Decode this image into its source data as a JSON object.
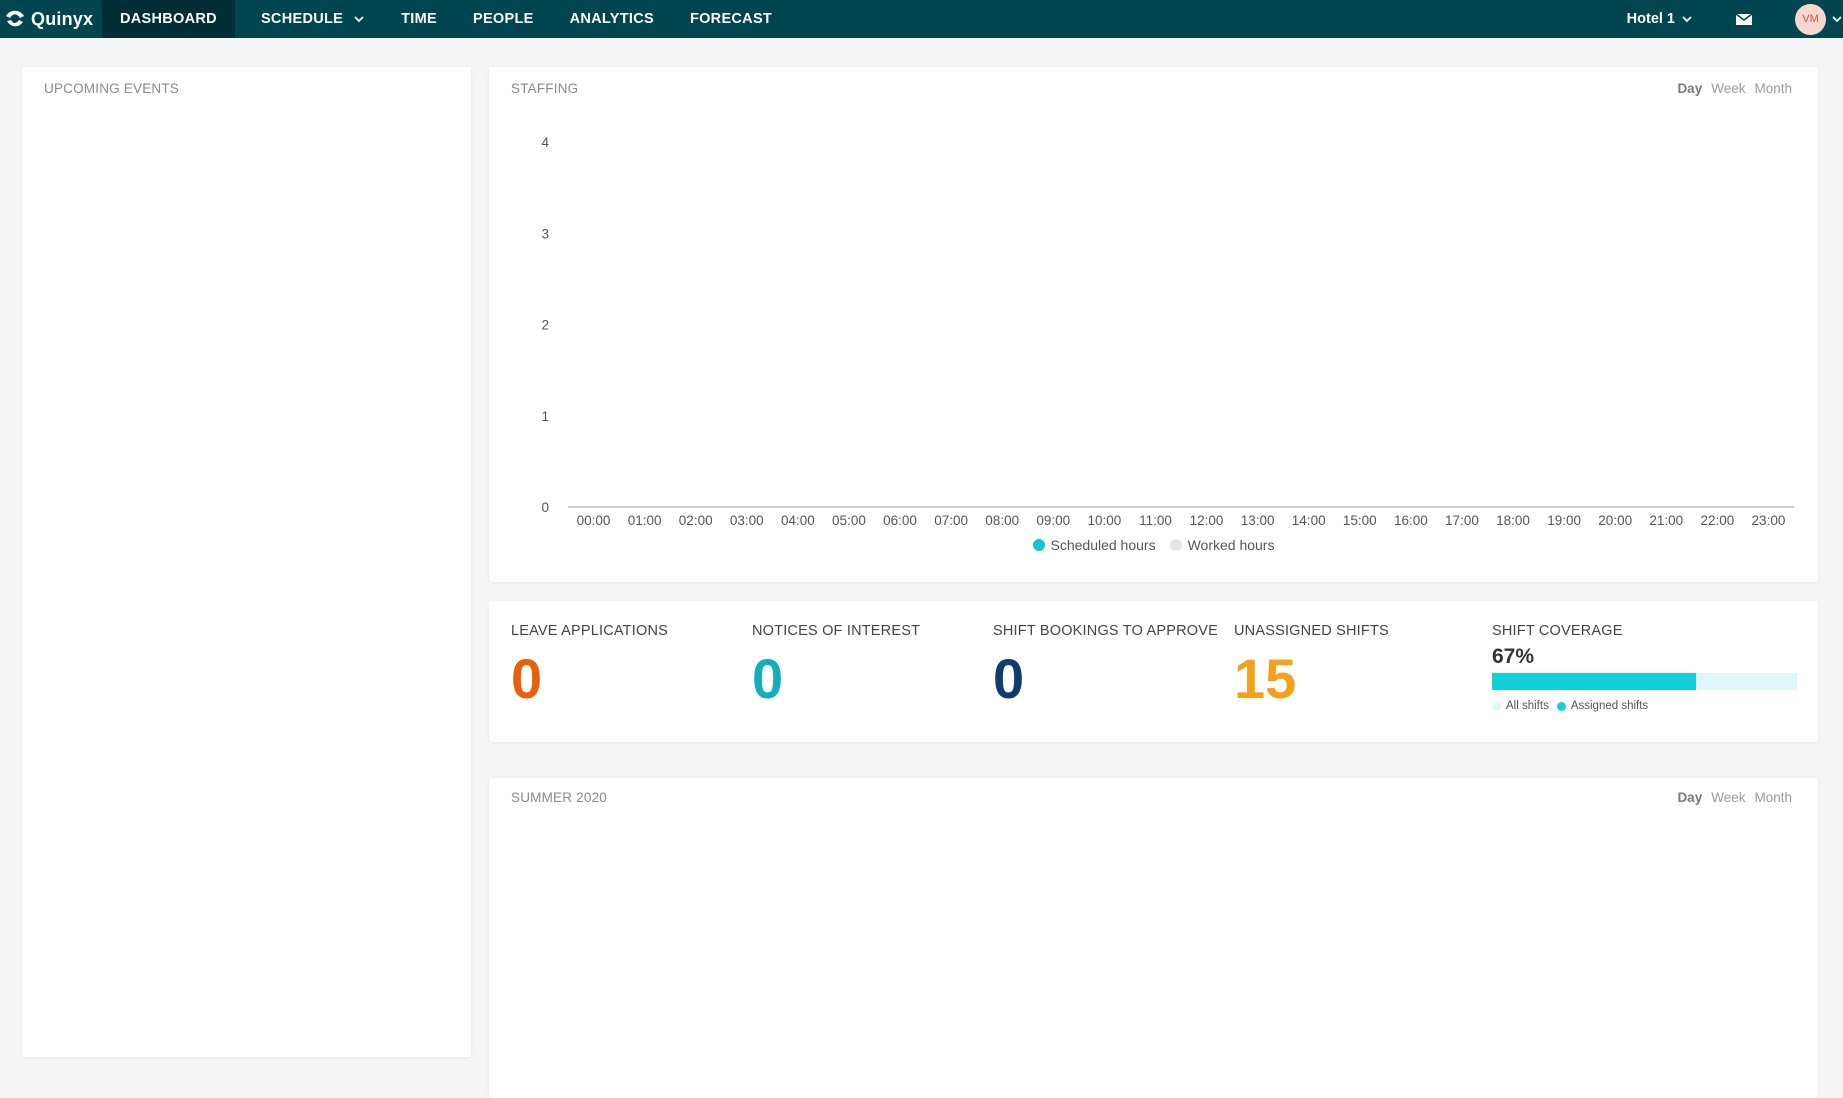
{
  "app": {
    "name": "Quinyx"
  },
  "nav": {
    "items": [
      {
        "label": "DASHBOARD",
        "active": true
      },
      {
        "label": "SCHEDULE",
        "dropdown": true
      },
      {
        "label": "TIME"
      },
      {
        "label": "PEOPLE"
      },
      {
        "label": "ANALYTICS"
      },
      {
        "label": "FORECAST"
      }
    ],
    "site": "Hotel 1",
    "user_initials": "VM"
  },
  "upcoming": {
    "title": "UPCOMING EVENTS"
  },
  "staffing": {
    "title": "STAFFING",
    "ranges": [
      "Day",
      "Week",
      "Month"
    ],
    "selected_range": "Day",
    "legend": {
      "scheduled": "Scheduled hours",
      "worked": "Worked hours"
    }
  },
  "chart_data": {
    "type": "line",
    "x": [
      "00:00",
      "01:00",
      "02:00",
      "03:00",
      "04:00",
      "05:00",
      "06:00",
      "07:00",
      "08:00",
      "09:00",
      "10:00",
      "11:00",
      "12:00",
      "13:00",
      "14:00",
      "15:00",
      "16:00",
      "17:00",
      "18:00",
      "19:00",
      "20:00",
      "21:00",
      "22:00",
      "23:00"
    ],
    "yticks": [
      0,
      1,
      2,
      3,
      4
    ],
    "ylim": [
      0,
      4
    ],
    "series": [
      {
        "name": "Scheduled hours",
        "color": "#12c6d0",
        "values": [
          0,
          0,
          0,
          0,
          0,
          0,
          0,
          0,
          0,
          0,
          0,
          0,
          0,
          0,
          0,
          0,
          0,
          0,
          0,
          0,
          0,
          0,
          0,
          0
        ]
      },
      {
        "name": "Worked hours",
        "color": "#e6e6e6",
        "values": [
          0,
          0,
          0,
          0,
          0,
          0,
          0,
          0,
          0,
          0,
          0,
          0,
          0,
          0,
          0,
          0,
          0,
          0,
          0,
          0,
          0,
          0,
          0,
          0
        ]
      }
    ],
    "legend": "bottom-center",
    "grid": false
  },
  "kpis": {
    "leave": {
      "label": "LEAVE APPLICATIONS",
      "value": "0",
      "color": "#e8600c"
    },
    "notices": {
      "label": "NOTICES OF INTEREST",
      "value": "0",
      "color": "#13aebd"
    },
    "bookings": {
      "label": "SHIFT BOOKINGS TO APPROVE",
      "value": "0",
      "color": "#0d3d6e"
    },
    "unassigned": {
      "label": "UNASSIGNED SHIFTS",
      "value": "15",
      "color": "#f5a01a"
    },
    "coverage": {
      "label": "SHIFT COVERAGE",
      "percent_text": "67%",
      "fraction": 0.67,
      "legend_all": "All shifts",
      "legend_assigned": "Assigned shifts",
      "color_all": "#e3f7f8",
      "color_assigned": "#12d0d6"
    }
  },
  "summer": {
    "title": "SUMMER 2020",
    "ranges": [
      "Day",
      "Week",
      "Month"
    ],
    "selected_range": "Day"
  }
}
